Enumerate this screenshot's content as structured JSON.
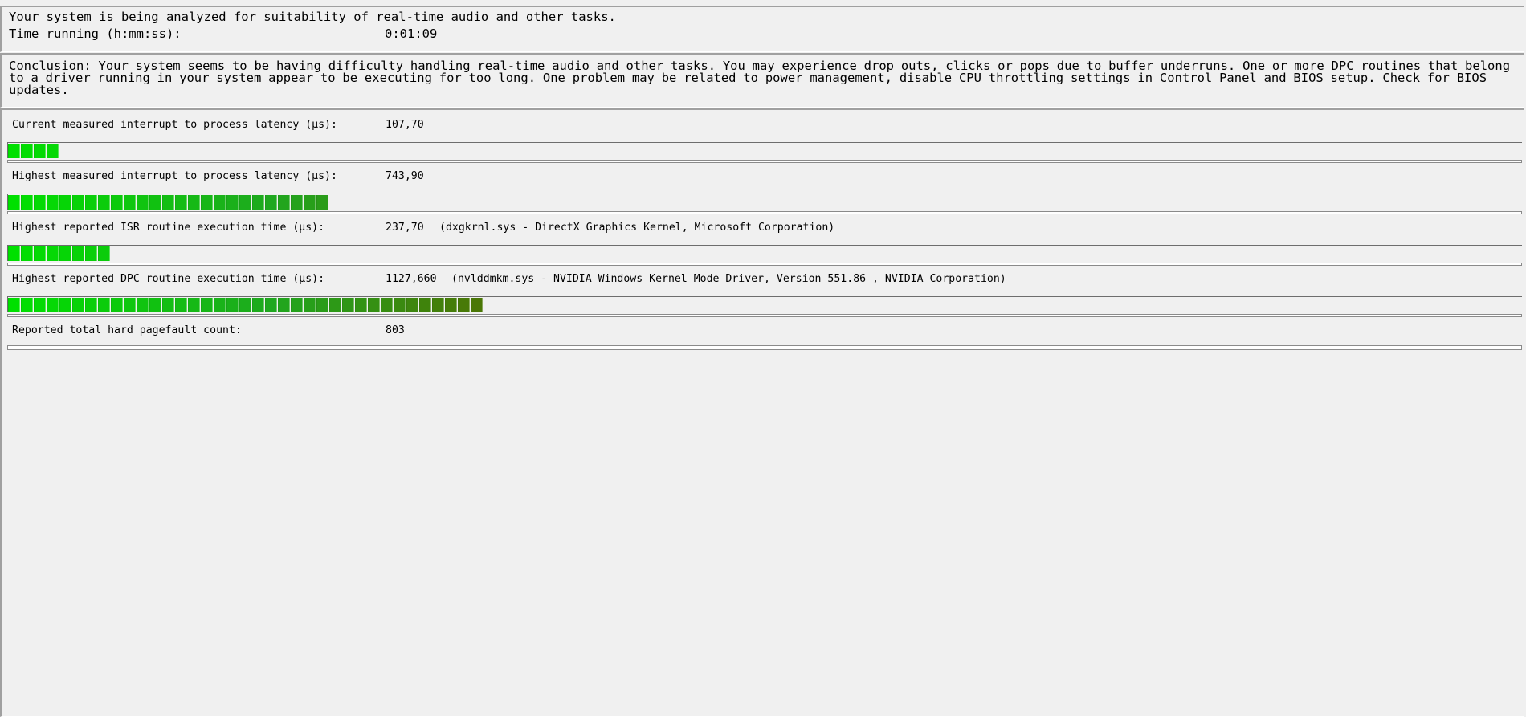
{
  "status": {
    "analysis_text": "Your system is being analyzed for suitability of real-time audio and other tasks.",
    "time_label": "Time running (h:mm:ss):",
    "time_value": "0:01:09"
  },
  "conclusion": {
    "text": "Conclusion: Your system seems to be having difficulty handling real-time audio and other tasks. You may experience drop outs, clicks or pops due to buffer underruns. One or more DPC routines that belong to a driver running in your system appear to be executing for too long. One problem may be related to power management, disable CPU throttling settings in Control Panel and BIOS setup. Check for BIOS updates."
  },
  "metrics": [
    {
      "label": "Current measured interrupt to process latency (µs):",
      "value": "107,70",
      "detail": "",
      "bar_segments": 4
    },
    {
      "label": "Highest measured interrupt to process latency (µs):",
      "value": "743,90",
      "detail": "",
      "bar_segments": 25
    },
    {
      "label": "Highest reported ISR routine execution time (µs):",
      "value": "237,70",
      "detail": "(dxgkrnl.sys - DirectX Graphics Kernel, Microsoft Corporation)",
      "bar_segments": 8
    },
    {
      "label": "Highest reported DPC routine execution time (µs):",
      "value": "1127,660",
      "detail": "(nvlddmkm.sys - NVIDIA Windows Kernel Mode Driver, Version 551.86 , NVIDIA Corporation)",
      "bar_segments": 37
    },
    {
      "label": "Reported total hard pagefault count:",
      "value": "803",
      "detail": "",
      "bar_segments": 0
    }
  ],
  "colors": {
    "bar_start": "#00e000",
    "bar_mid": "#1fa81f",
    "bar_end": "#556b00",
    "panel_bg": "#f0f0f0"
  }
}
